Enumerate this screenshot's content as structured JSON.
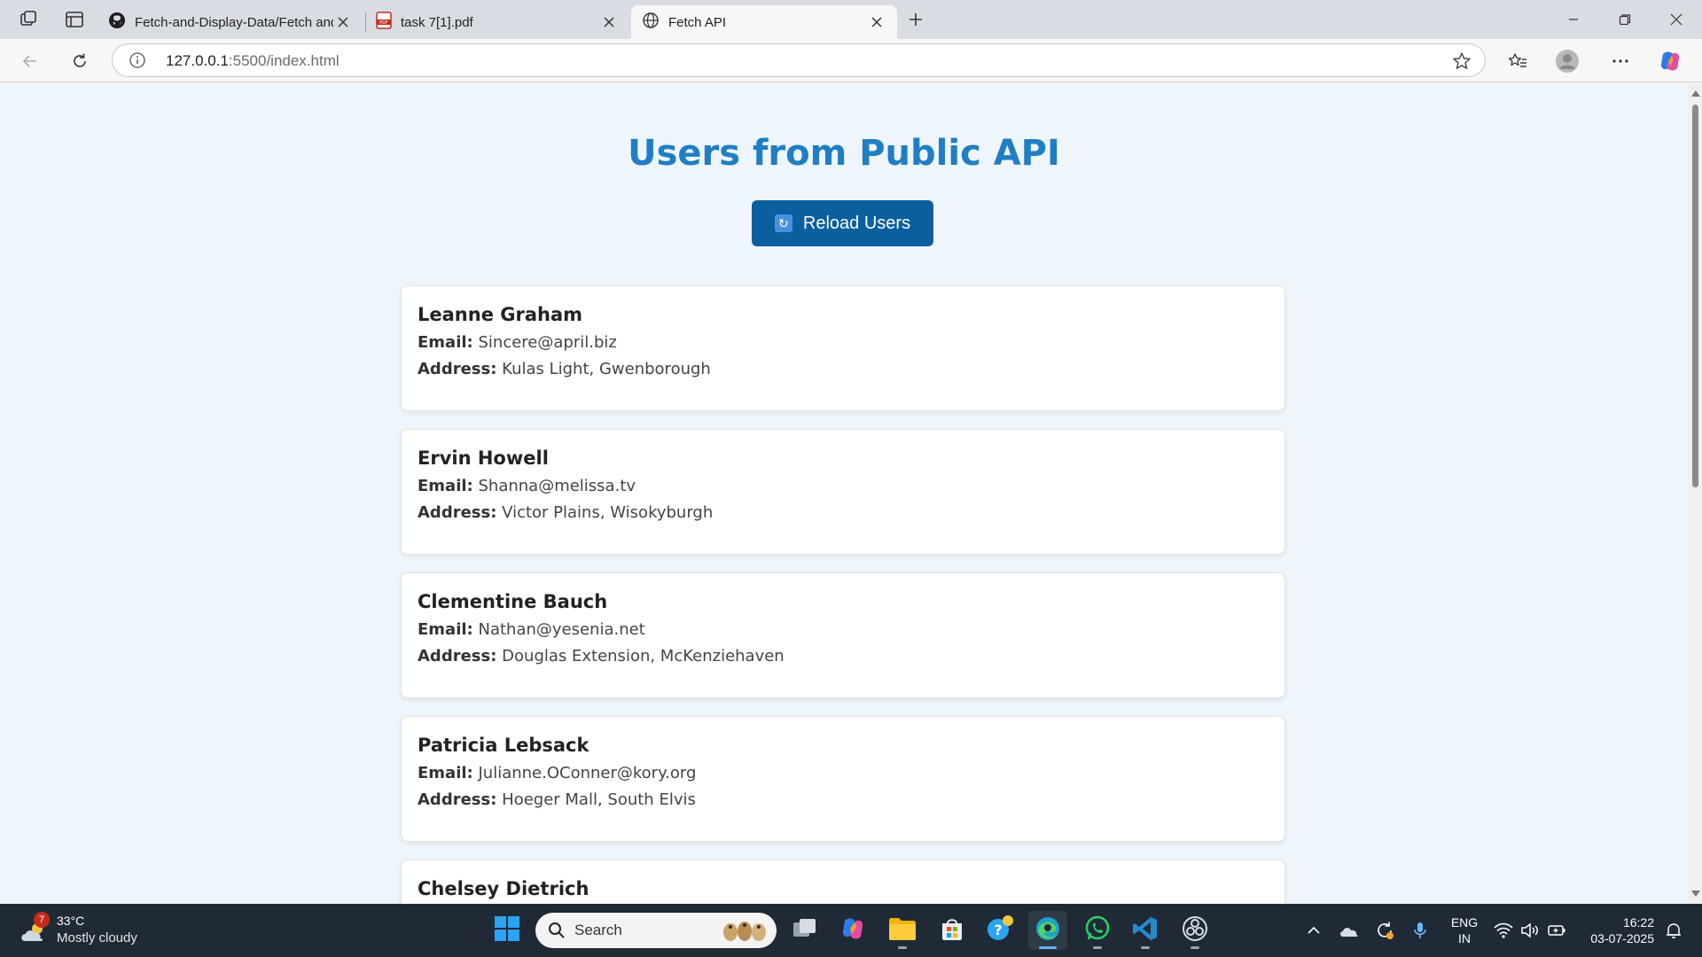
{
  "browser": {
    "tabs": [
      {
        "title": "Fetch-and-Display-Data/Fetch and",
        "icon": "github-icon"
      },
      {
        "title": "task 7[1].pdf",
        "icon": "pdf-icon"
      },
      {
        "title": "Fetch API",
        "icon": "globe-icon",
        "active": true
      }
    ],
    "url_host": "127.0.0.1",
    "url_rest": ":5500/index.html"
  },
  "page": {
    "title": "Users from Public API",
    "reload_label": "Reload Users",
    "email_label": "Email:",
    "address_label": "Address:",
    "users": [
      {
        "name": "Leanne Graham",
        "email": "Sincere@april.biz",
        "address": "Kulas Light, Gwenborough"
      },
      {
        "name": "Ervin Howell",
        "email": "Shanna@melissa.tv",
        "address": "Victor Plains, Wisokyburgh"
      },
      {
        "name": "Clementine Bauch",
        "email": "Nathan@yesenia.net",
        "address": "Douglas Extension, McKenziehaven"
      },
      {
        "name": "Patricia Lebsack",
        "email": "Julianne.OConner@kory.org",
        "address": "Hoeger Mall, South Elvis"
      },
      {
        "name": "Chelsey Dietrich"
      }
    ]
  },
  "taskbar": {
    "weather_badge": "7",
    "temperature": "33°C",
    "condition": "Mostly cloudy",
    "search_label": "Search",
    "lang_line1": "ENG",
    "lang_line2": "IN",
    "time": "16:22",
    "date": "03-07-2025"
  },
  "colors": {
    "title": "#1f7ec4",
    "button": "#0a5f9e",
    "page_bg": "#eef6fc",
    "taskbar": "#1f2a36"
  }
}
